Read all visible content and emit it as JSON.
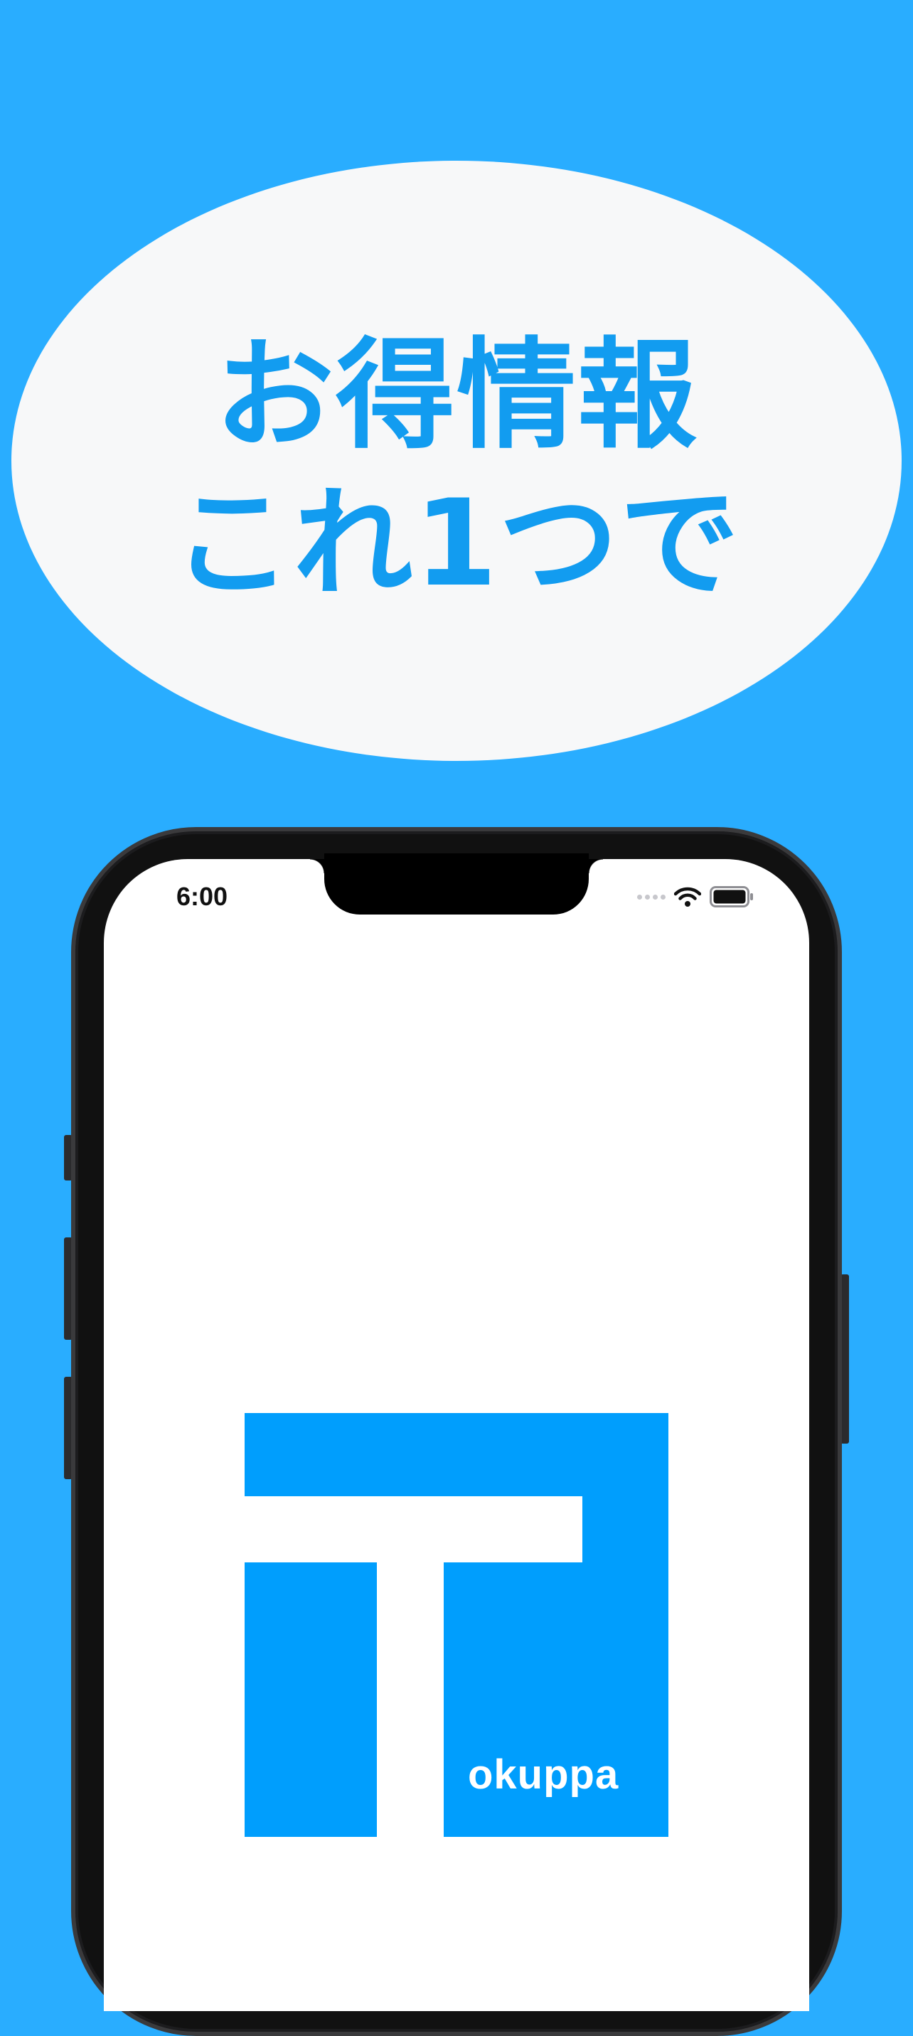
{
  "banner": {
    "headline_line1": "お得情報",
    "headline_line2": "これ1つで"
  },
  "status_bar": {
    "time": "6:00",
    "icons": [
      "signal-dots-icon",
      "wifi-icon",
      "battery-icon"
    ]
  },
  "app": {
    "brand": "okuppa",
    "logo_color": "#009efd"
  },
  "colors": {
    "background": "#29adff",
    "headline": "#129cf0",
    "bubble": "#f7f8f9",
    "screen": "#ffffff"
  }
}
